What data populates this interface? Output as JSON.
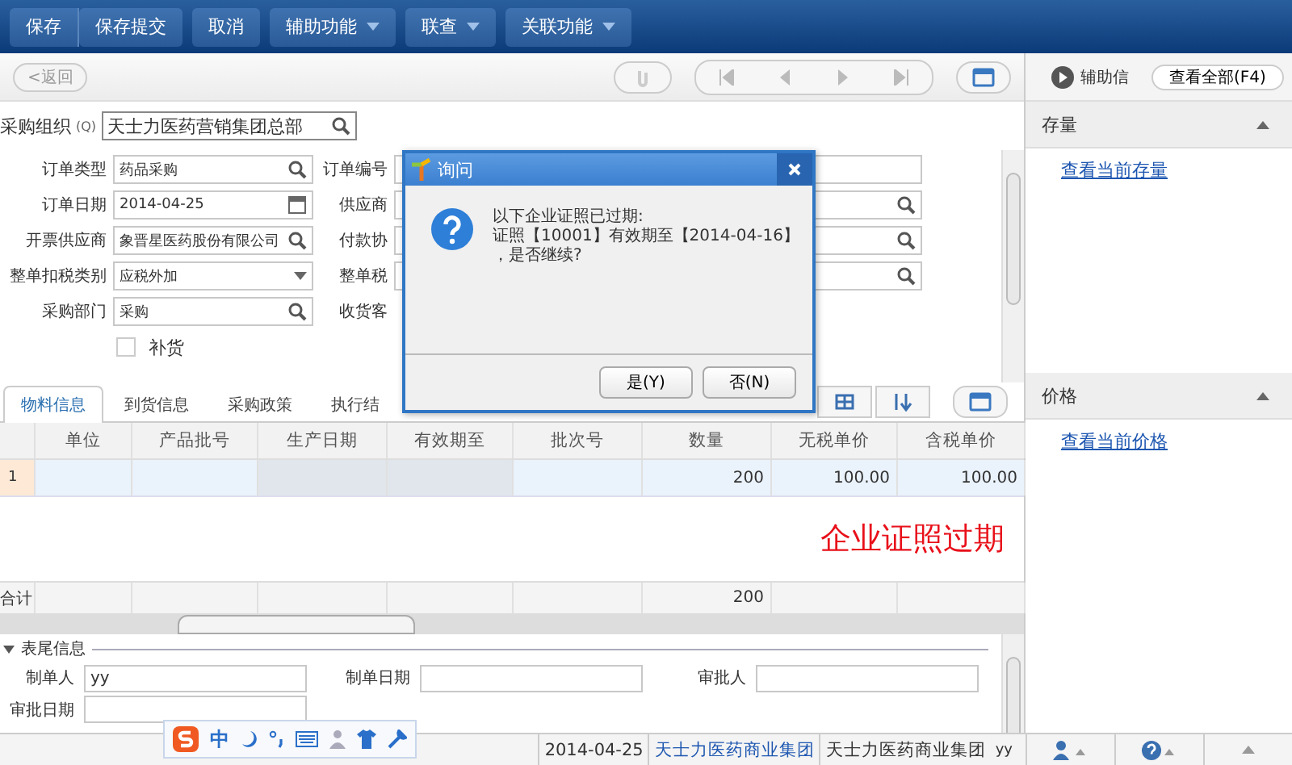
{
  "toolbar": {
    "buttons": [
      {
        "label": "保存",
        "kind": "joined"
      },
      {
        "label": "保存提交",
        "kind": "plain"
      },
      {
        "label": "取消",
        "kind": "plain"
      },
      {
        "label": "辅助功能",
        "kind": "menu"
      },
      {
        "label": "联查",
        "kind": "menu"
      },
      {
        "label": "关联功能",
        "kind": "menu"
      }
    ]
  },
  "nav": {
    "back": "<返回"
  },
  "org": {
    "label": "采购组织",
    "shortcut": "(Q)",
    "value": "天士力医药营销集团总部"
  },
  "form": {
    "left": [
      {
        "label": "订单类型",
        "value": "药品采购",
        "kind": "lookup"
      },
      {
        "label": "订单日期",
        "value": "2014-04-25",
        "kind": "date"
      },
      {
        "label": "开票供应商",
        "value": "象晋星医药股份有限公司",
        "kind": "lookup"
      },
      {
        "label": "整单扣税类别",
        "value": "应税外加",
        "kind": "select"
      },
      {
        "label": "采购部门",
        "value": "采购",
        "kind": "lookup"
      },
      {
        "label": "补货",
        "kind": "checkbox",
        "checked": false
      }
    ],
    "right": [
      {
        "label": "订单编号",
        "kind": "text"
      },
      {
        "label": "供应商",
        "kind": "lookup"
      },
      {
        "label": "付款协",
        "kind": "lookup"
      },
      {
        "label": "整单税",
        "kind": "lookup"
      },
      {
        "label": "收货客",
        "kind": "blank"
      }
    ]
  },
  "tabs": [
    {
      "label": "物料信息",
      "selected": true
    },
    {
      "label": "到货信息",
      "selected": false
    },
    {
      "label": "采购政策",
      "selected": false
    },
    {
      "label": "执行结",
      "selected": false
    }
  ],
  "table": {
    "columns": [
      "单位",
      "产品批号",
      "生产日期",
      "有效期至",
      "批次号",
      "数量",
      "无税单价",
      "含税单价"
    ],
    "rows": [
      {
        "index": "1",
        "cells": [
          "",
          "",
          "",
          "",
          "",
          "200",
          "100.00",
          "100.00"
        ]
      }
    ],
    "total": {
      "label": "合计",
      "cells": [
        "",
        "",
        "",
        "",
        "",
        "200",
        "",
        ""
      ]
    }
  },
  "stamp": "企业证照过期",
  "footer": {
    "title": "表尾信息",
    "expanded": true,
    "fields": [
      {
        "label": "制单人",
        "value": "yy"
      },
      {
        "label": "制单日期"
      },
      {
        "label": "审批人"
      }
    ],
    "cut_label": "审批日期"
  },
  "side": {
    "title": "辅助信",
    "view_all": "查看全部(F4)",
    "sections": [
      {
        "title": "存量",
        "link": "查看当前存量"
      },
      {
        "title": "价格",
        "link": "查看当前价格"
      }
    ]
  },
  "status": {
    "date": "2014-04-25",
    "org": "天士力医药商业集团",
    "group": "天士力医药商业集团",
    "user": "yy"
  },
  "ime": {
    "mode": "中"
  },
  "dialog": {
    "title": "询问",
    "lines": [
      "以下企业证照已过期:",
      "证照【10001】有效期至【2014-04-16】",
      "，是否继续?"
    ],
    "buttons": [
      "是(Y)",
      "否(N)"
    ]
  }
}
